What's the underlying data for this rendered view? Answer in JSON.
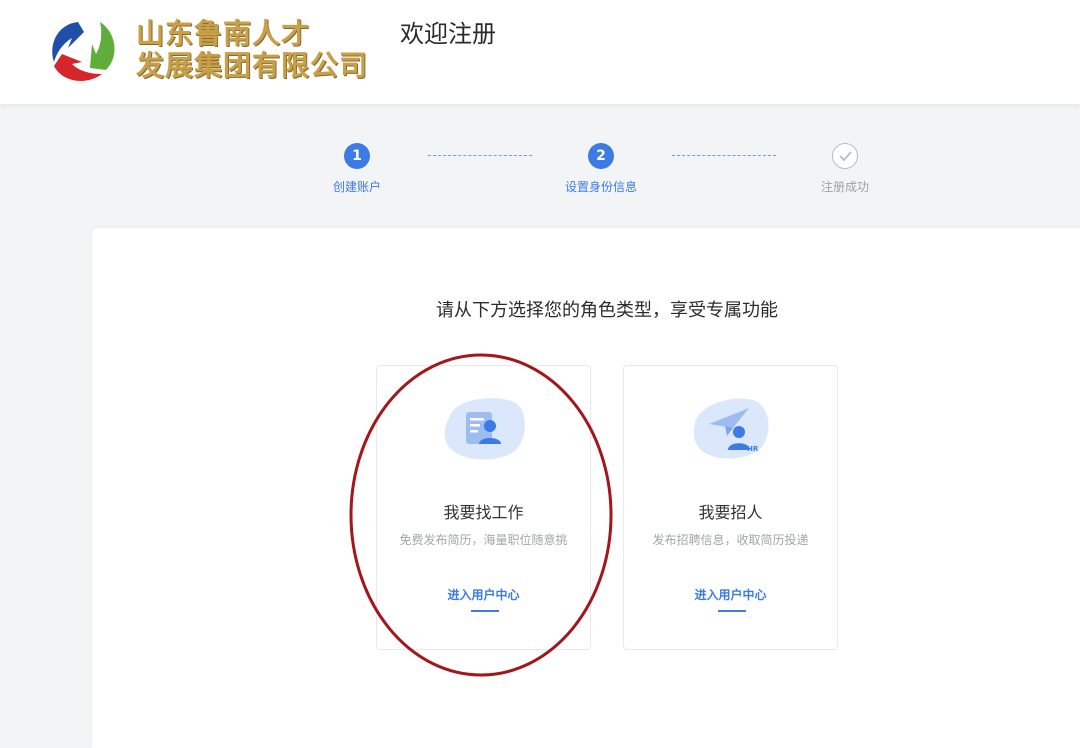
{
  "header": {
    "brand_line1": "山东鲁南人才",
    "brand_line2": "发展集团有限公司",
    "title": "欢迎注册"
  },
  "steps": [
    {
      "number": "1",
      "label": "创建账户",
      "state": "active",
      "icon": null
    },
    {
      "number": "2",
      "label": "设置身份信息",
      "state": "active",
      "icon": null
    },
    {
      "number": "",
      "label": "注册成功",
      "state": "pending",
      "icon": "check-icon"
    }
  ],
  "main": {
    "prompt": "请从下方选择您的角色类型，享受专属功能",
    "roles": [
      {
        "title": "我要找工作",
        "description": "免费发布简历，海量职位随意挑",
        "link": "进入用户中心",
        "icon": "resume-person-icon"
      },
      {
        "title": "我要招人",
        "description": "发布招聘信息，收取简历投递",
        "link": "进入用户中心",
        "icon": "paper-plane-hr-icon"
      }
    ]
  },
  "colors": {
    "accent": "#3c7be6",
    "brand_gold": "#c9a04a",
    "annotation": "#a3161a",
    "page_bg": "#f3f4f6"
  }
}
